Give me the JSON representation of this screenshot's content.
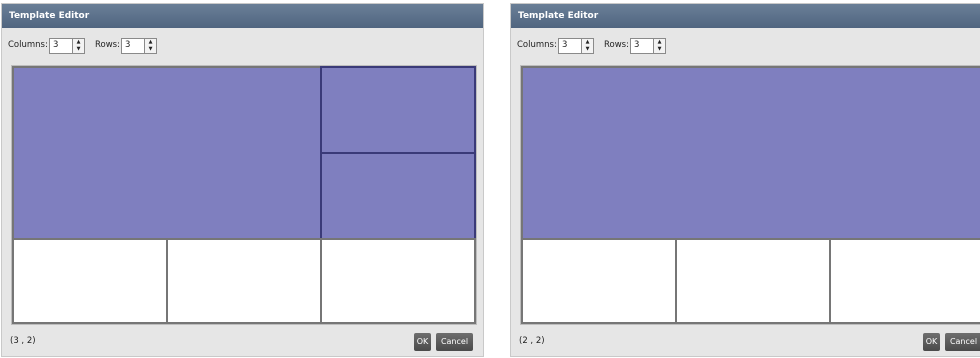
{
  "dialogs": [
    {
      "title": "Template Editor",
      "columns_label": "Columns:",
      "columns_value": "3",
      "rows_label": "Rows:",
      "rows_value": "3",
      "status": "(3 , 2)",
      "ok_label": "OK",
      "cancel_label": "Cancel"
    },
    {
      "title": "Template Editor",
      "columns_label": "Columns:",
      "columns_value": "3",
      "rows_label": "Rows:",
      "rows_value": "3",
      "status": "(2 , 2)",
      "ok_label": "OK",
      "cancel_label": "Cancel"
    }
  ],
  "icons": {
    "spin_up": "▲",
    "spin_down": "▼"
  },
  "colors": {
    "selection": "#7f7fbf",
    "cell_border": "#767676",
    "titlebar": "#5b7089"
  }
}
